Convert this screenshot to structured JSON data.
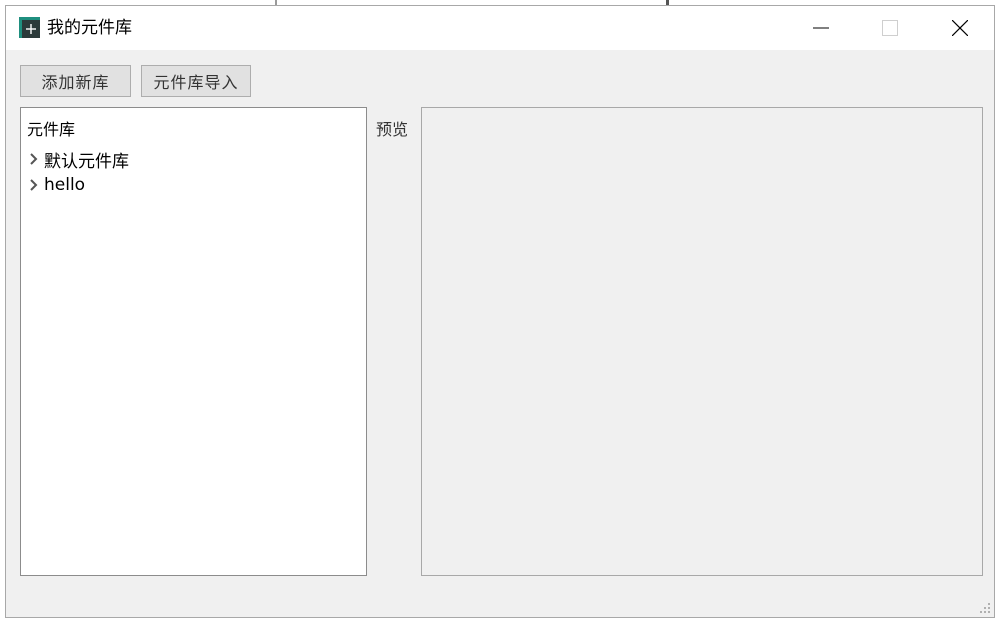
{
  "window": {
    "title": "我的元件库"
  },
  "toolbar": {
    "add_library_label": "添加新库",
    "import_library_label": "元件库导入"
  },
  "tree": {
    "header": "元件库",
    "items": [
      {
        "label": "默认元件库"
      },
      {
        "label": "hello"
      }
    ]
  },
  "preview": {
    "label": "预览"
  },
  "icons": {
    "app": "app-icon",
    "minimize": "minimize-icon",
    "maximize": "maximize-icon",
    "close": "close-icon",
    "expand": "chevron-right-icon",
    "resize": "resize-grip-icon"
  },
  "colors": {
    "app_icon_teal": "#1f8f7f",
    "app_icon_dark": "#2b3a3a",
    "window_bg": "#f0f0f0",
    "button_bg": "#e1e1e1"
  }
}
